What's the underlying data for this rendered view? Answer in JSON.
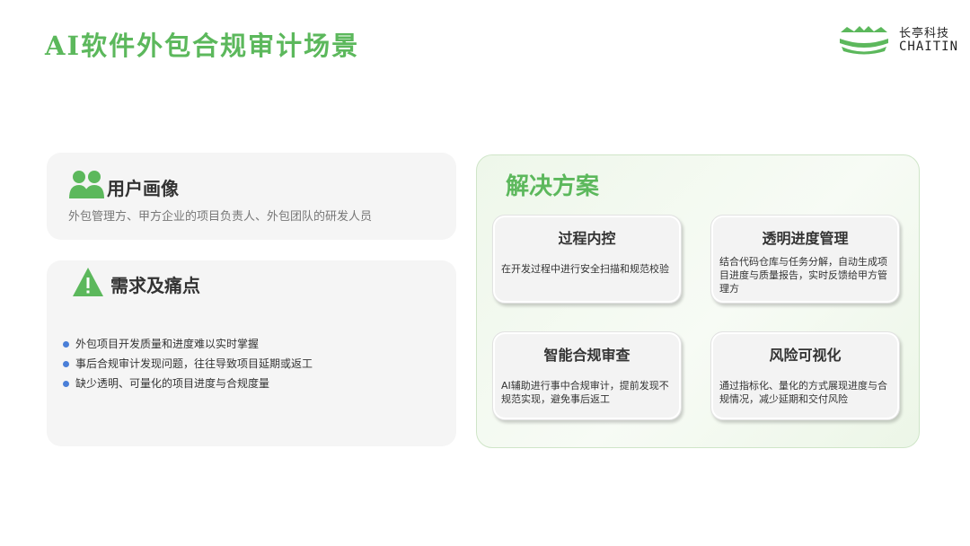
{
  "page": {
    "title": "AI软件外包合规审计场景"
  },
  "logo": {
    "cn": "长亭科技",
    "en": "CHAITIN",
    "color": "#5cb85c"
  },
  "persona": {
    "icon": "users-icon",
    "title": "用户画像",
    "description": "外包管理方、甲方企业的项目负责人、外包团队的研发人员"
  },
  "needs": {
    "icon": "warning-icon",
    "title": "需求及痛点",
    "items": [
      "外包项目开发质量和进度难以实时掌握",
      "事后合规审计发现问题，往往导致项目延期或返工",
      "缺少透明、可量化的项目进度与合规度量"
    ]
  },
  "solution": {
    "title": "解决方案",
    "cards": [
      {
        "title": "过程内控",
        "description": "在开发过程中进行安全扫描和规范校验"
      },
      {
        "title": "透明进度管理",
        "description": "结合代码仓库与任务分解，自动生成项目进度与质量报告，实时反馈给甲方管理方"
      },
      {
        "title": "智能合规审查",
        "description": "AI辅助进行事中合规审计，提前发现不规范实现，避免事后返工"
      },
      {
        "title": "风险可视化",
        "description": "通过指标化、量化的方式展现进度与合规情况，减少延期和交付风险"
      }
    ]
  },
  "colors": {
    "accent": "#5cb85c",
    "bullet": "#4a7fd8"
  }
}
